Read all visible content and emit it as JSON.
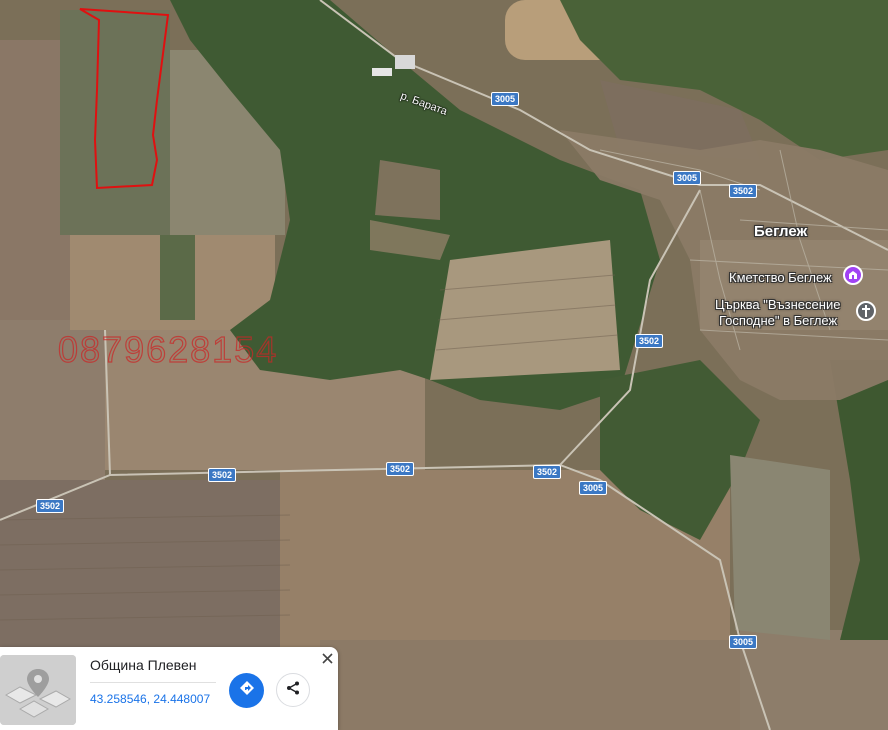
{
  "map": {
    "type": "satellite",
    "watermark_text": "0879628154",
    "river_label": "р. Барата",
    "town_label": "Беглеж",
    "poi": [
      {
        "label_lines": [
          "Кметство Беглеж"
        ],
        "icon": "town-hall-icon",
        "color": "#a142f4"
      },
      {
        "label_lines": [
          "Църква \"Възнесение",
          "Господне\" в Беглеж"
        ],
        "icon": "church-icon",
        "color": "#5f6368"
      }
    ],
    "road_shields": [
      "3005",
      "3005",
      "3502",
      "3502",
      "3502",
      "3502",
      "3502",
      "3005",
      "3005"
    ],
    "boundary_color": "#e01010"
  },
  "card": {
    "title": "Община Плевен",
    "coordinates": "43.258546, 24.448007",
    "directions_icon": "directions-icon",
    "share_icon": "share-icon",
    "close_icon": "close-icon",
    "accent": "#1a73e8"
  }
}
